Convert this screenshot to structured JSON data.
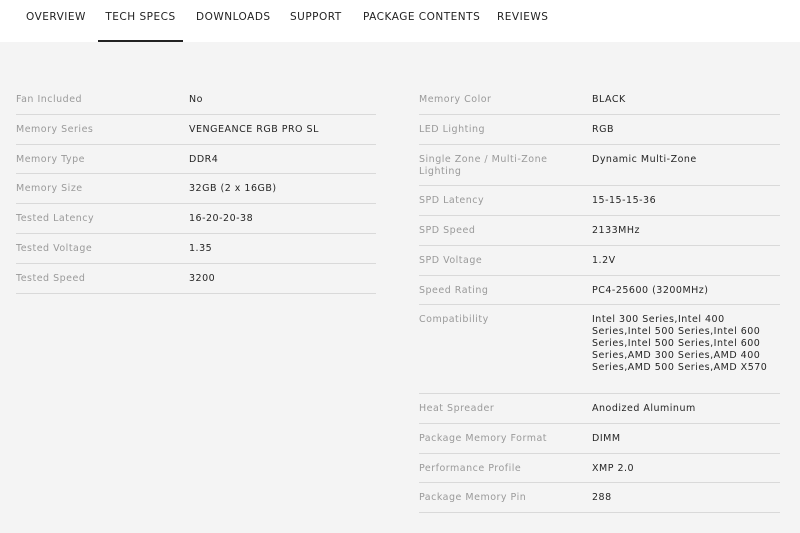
{
  "tabs": [
    {
      "label": "OVERVIEW"
    },
    {
      "label": "TECH SPECS"
    },
    {
      "label": "DOWNLOADS"
    },
    {
      "label": "SUPPORT"
    },
    {
      "label": "PACKAGE CONTENTS"
    },
    {
      "label": "REVIEWS"
    }
  ],
  "active_tab": "TECH SPECS",
  "left_specs": [
    {
      "label": "Fan Included",
      "value": "No"
    },
    {
      "label": "Memory Series",
      "value": "VENGEANCE RGB PRO SL"
    },
    {
      "label": "Memory Type",
      "value": "DDR4"
    },
    {
      "label": "Memory Size",
      "value": "32GB (2 x 16GB)"
    },
    {
      "label": "Tested Latency",
      "value": "16-20-20-38"
    },
    {
      "label": "Tested Voltage",
      "value": "1.35"
    },
    {
      "label": "Tested Speed",
      "value": "3200"
    }
  ],
  "right_specs": [
    {
      "label": "Memory Color",
      "value": "BLACK"
    },
    {
      "label": "LED Lighting",
      "value": "RGB"
    },
    {
      "label": "Single Zone / Multi-Zone Lighting",
      "value": "Dynamic Multi-Zone"
    },
    {
      "label": "SPD Latency",
      "value": "15-15-15-36"
    },
    {
      "label": "SPD Speed",
      "value": "2133MHz"
    },
    {
      "label": "SPD Voltage",
      "value": "1.2V"
    },
    {
      "label": "Speed Rating",
      "value": "PC4-25600 (3200MHz)"
    },
    {
      "label": "Compatibility",
      "value": "Intel 300 Series,Intel 400 Series,Intel 500 Series,Intel 600 Series,Intel 500 Series,Intel 600 Series,AMD 300 Series,AMD 400 Series,AMD 500 Series,AMD X570"
    },
    {
      "label": "Heat Spreader",
      "value": "Anodized Aluminum"
    },
    {
      "label": "Package Memory Format",
      "value": "DIMM"
    },
    {
      "label": "Performance Profile",
      "value": "XMP 2.0"
    },
    {
      "label": "Package Memory Pin",
      "value": "288"
    }
  ],
  "colors": {
    "page_background": "#f4f4f4",
    "tabbar_background": "#ffffff",
    "label_text": "#9a9a9a",
    "value_text": "#262626",
    "divider": "#d9d9d9",
    "active_underline": "#222222"
  }
}
